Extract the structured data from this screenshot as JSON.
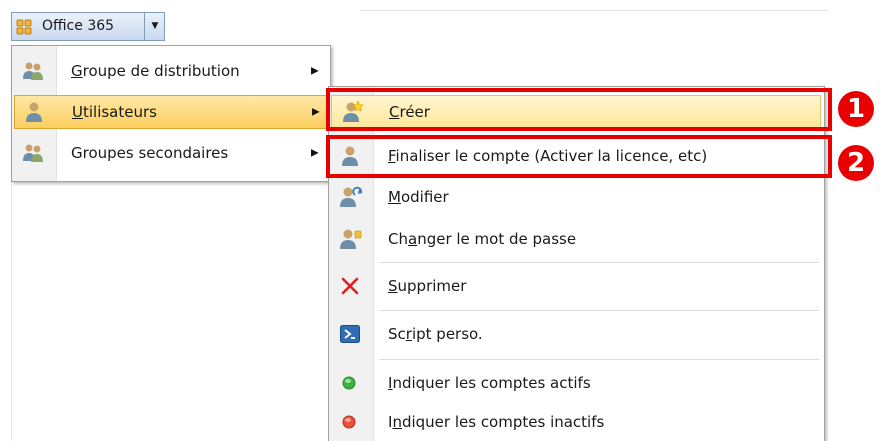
{
  "toolbar": {
    "label": "Office 365"
  },
  "menu1": {
    "items": [
      {
        "pre": "",
        "u": "G",
        "post": "roupe de distribution"
      },
      {
        "pre": "",
        "u": "U",
        "post": "tilisateurs"
      },
      {
        "pre": "Groupes secondaires",
        "u": "",
        "post": ""
      }
    ]
  },
  "menu2": {
    "items": [
      {
        "pre": "",
        "u": "C",
        "post": "réer"
      },
      {
        "pre": "",
        "u": "F",
        "post": "inaliser le compte (Activer la licence, etc)"
      },
      {
        "pre": "",
        "u": "M",
        "post": "odifier"
      },
      {
        "pre": "Ch",
        "u": "a",
        "post": "nger le mot de passe"
      },
      {
        "pre": "",
        "u": "S",
        "post": "upprimer"
      },
      {
        "pre": "Sc",
        "u": "r",
        "post": "ipt perso."
      },
      {
        "pre": "",
        "u": "I",
        "post": "ndiquer les comptes actifs"
      },
      {
        "pre": "I",
        "u": "n",
        "post": "diquer les comptes inactifs"
      }
    ]
  },
  "callouts": {
    "one": "1",
    "two": "2"
  },
  "colors": {
    "annotation_red": "#e80000",
    "highlight": "#ffe79a",
    "delete_red": "#e02020",
    "active_green": "#3cb043",
    "inactive_red": "#e8503a"
  }
}
